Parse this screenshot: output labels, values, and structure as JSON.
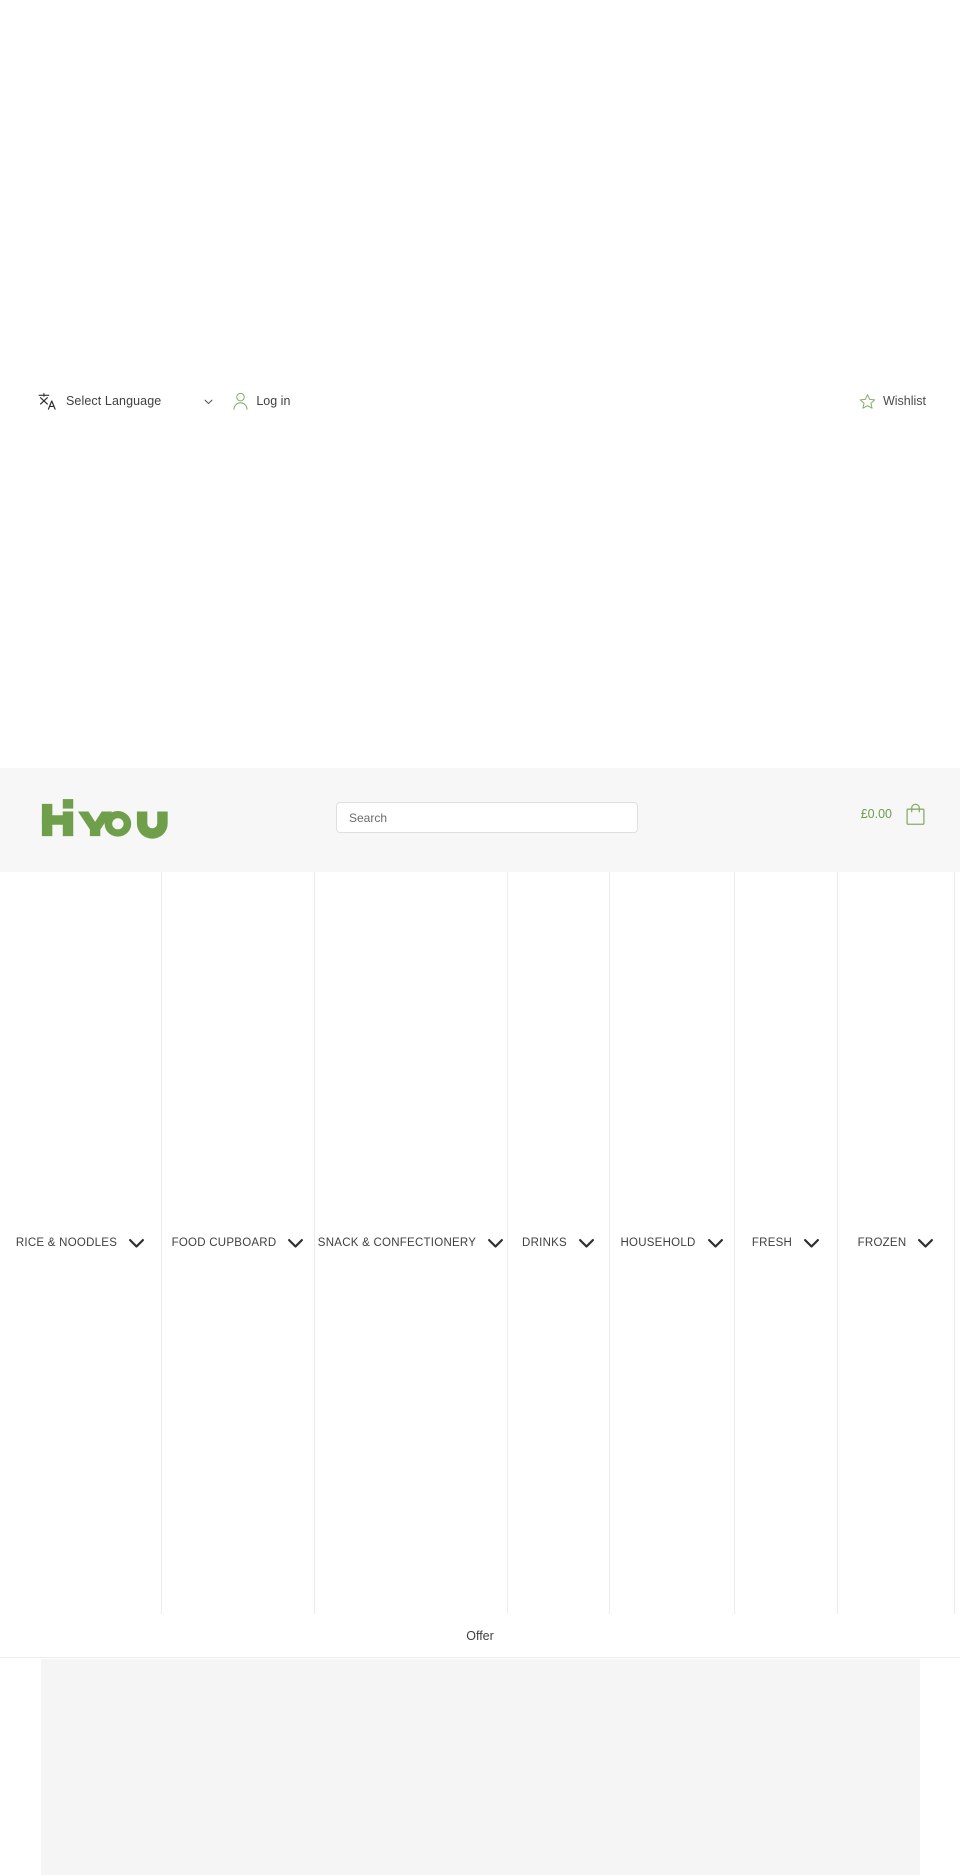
{
  "utility_bar": {
    "language": {
      "icon": "translate-icon",
      "label": "Select Language",
      "chevron": "chevron-down-icon"
    },
    "login": {
      "icon": "person-icon",
      "label": "Log in"
    },
    "wishlist": {
      "icon": "star-icon",
      "label": "Wishlist"
    }
  },
  "header": {
    "logo": {
      "text": "HYOU",
      "color": "#6f9f4a"
    },
    "search": {
      "placeholder": "Search",
      "value": ""
    },
    "cart": {
      "total": "£0.00",
      "icon": "shopping-bag-icon"
    }
  },
  "categories": [
    {
      "label": "RICE & NOODLES",
      "chevron": "chevron-down-icon"
    },
    {
      "label": "FOOD CUPBOARD",
      "chevron": "chevron-down-icon"
    },
    {
      "label": "SNACK & CONFECTIONERY",
      "chevron": "chevron-down-icon"
    },
    {
      "label": "DRINKS",
      "chevron": "chevron-down-icon"
    },
    {
      "label": "HOUSEHOLD",
      "chevron": "chevron-down-icon"
    },
    {
      "label": "FRESH",
      "chevron": "chevron-down-icon"
    },
    {
      "label": "FROZEN",
      "chevron": "chevron-down-icon"
    }
  ],
  "offer": {
    "label": "Offer"
  },
  "colors": {
    "brand_green": "#6f9f4a",
    "header_band": "#f7f7f7",
    "placeholder_block": "#f5f5f5",
    "divider": "#ececec",
    "text": "#3f3f3f"
  }
}
